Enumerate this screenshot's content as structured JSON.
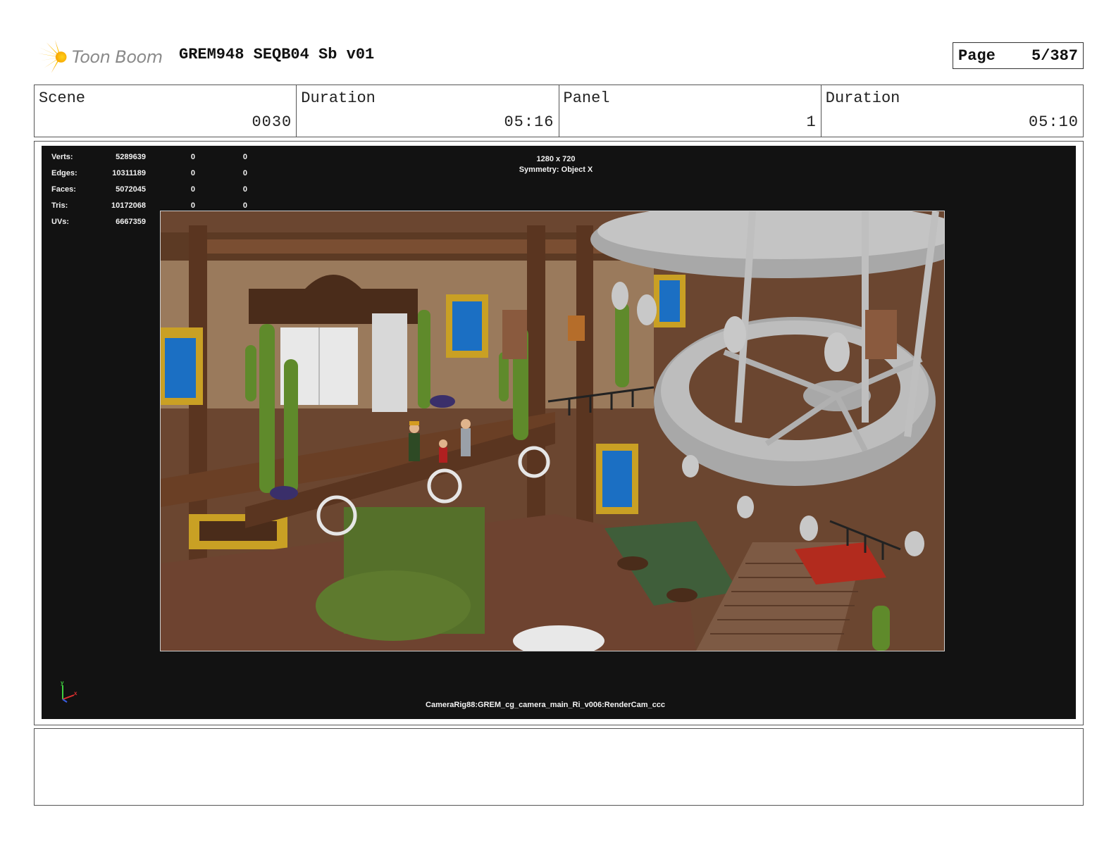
{
  "header": {
    "logo_text": "Toon Boom",
    "title": "GREM948 SEQB04 Sb v01",
    "page_label": "Page",
    "page_value": "5/387"
  },
  "info": {
    "scene_label": "Scene",
    "scene_value": "0030",
    "duration1_label": "Duration",
    "duration1_value": "05:16",
    "panel_label": "Panel",
    "panel_value": "1",
    "duration2_label": "Duration",
    "duration2_value": "05:10"
  },
  "viewport": {
    "stats": [
      {
        "label": "Verts:",
        "value": "5289639",
        "a": "0",
        "b": "0"
      },
      {
        "label": "Edges:",
        "value": "10311189",
        "a": "0",
        "b": "0"
      },
      {
        "label": "Faces:",
        "value": "5072045",
        "a": "0",
        "b": "0"
      },
      {
        "label": "Tris:",
        "value": "10172068",
        "a": "0",
        "b": "0"
      },
      {
        "label": "UVs:",
        "value": "6667359",
        "a": "0",
        "b": "0"
      }
    ],
    "resolution": "1280 x 720",
    "symmetry": "Symmetry: Object X",
    "camera": "CameraRig88:GREM_cg_camera_main_Ri_v006:RenderCam_ccc",
    "axis_labels": {
      "y": "y",
      "x": "x"
    }
  },
  "notes": {
    "text": ""
  }
}
